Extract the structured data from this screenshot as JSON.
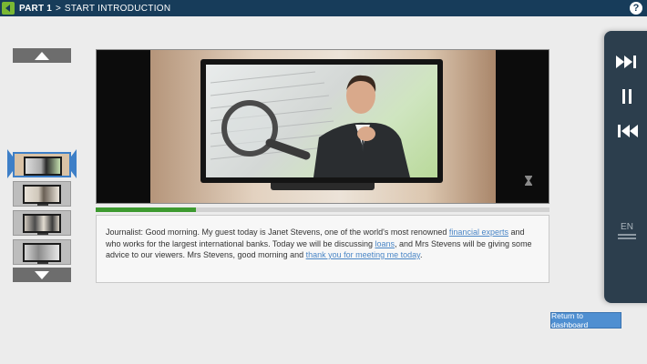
{
  "header": {
    "part_label": "PART 1",
    "separator": ">",
    "current_section": "START INTRODUCTION",
    "help_label": "?"
  },
  "player": {
    "progress_percent": 22
  },
  "transcript": {
    "seg1": "Journalist: Good morning. My guest today is Janet Stevens, one of the world's most renowned ",
    "link1": "financial experts",
    "seg2": " and who works for the largest international banks. Today we will be discussing ",
    "link2": "loans",
    "seg3": ", and Mrs Stevens will be giving some advice to our viewers. Mrs Stevens, good morning and ",
    "link3": "thank you for meeting me today",
    "seg4": "."
  },
  "controls": {
    "language": "EN"
  },
  "return_button": {
    "label": "Return to dashboard"
  },
  "colors": {
    "header_bg": "#173c5a",
    "accent_green": "#7ab833",
    "link_blue": "#4a86c6",
    "panel_bg": "#2c3e4d",
    "progress_green": "#3d9a2f"
  }
}
